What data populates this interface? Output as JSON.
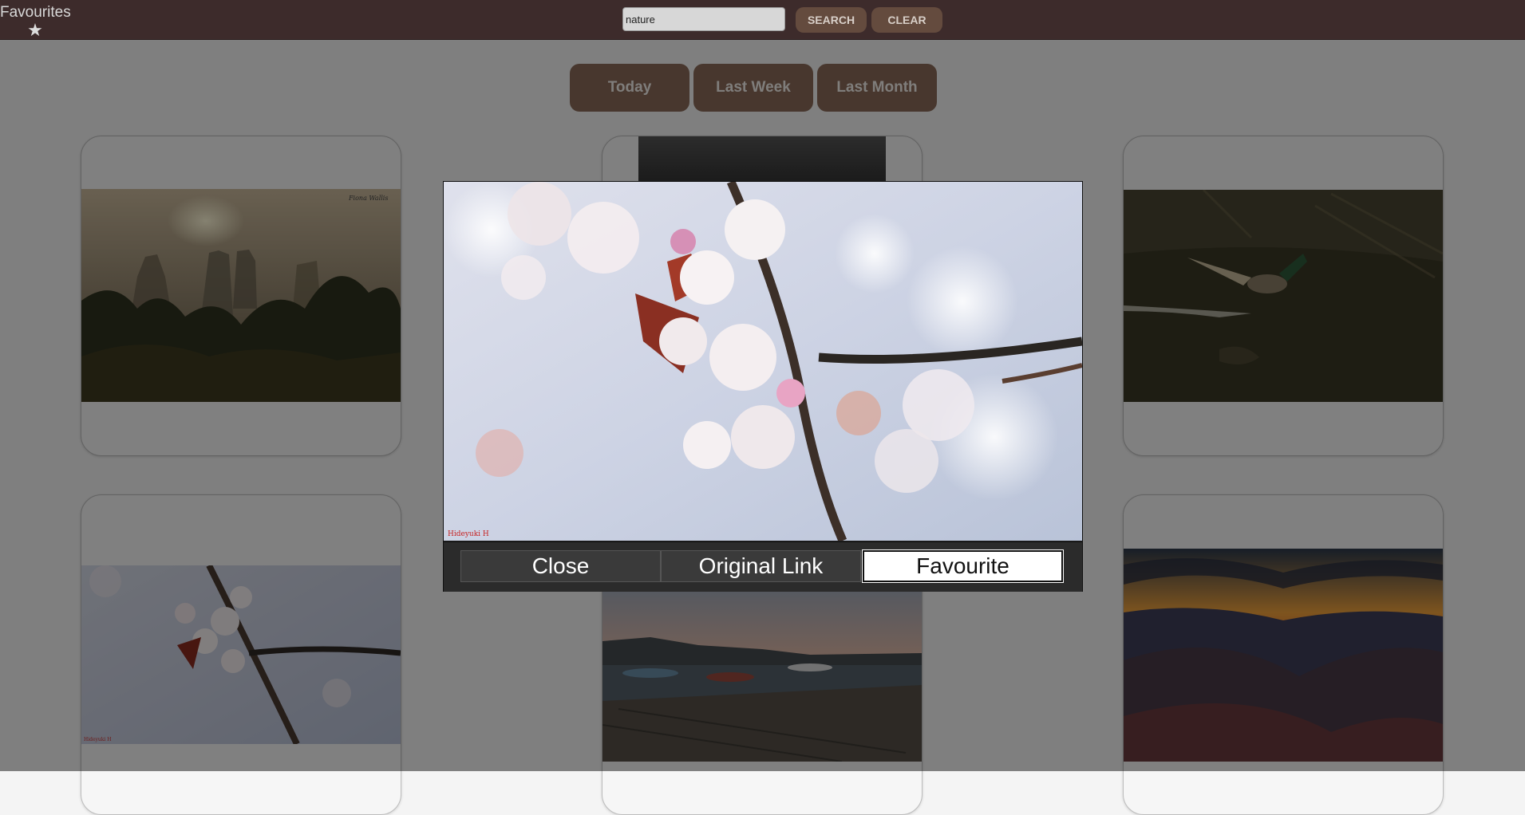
{
  "header": {
    "favourites_label": "Favourites",
    "search_value": "nature",
    "search_label": "SEARCH",
    "clear_label": "CLEAR"
  },
  "filters": {
    "today": "Today",
    "last_week": "Last Week",
    "last_month": "Last Month"
  },
  "gallery": {
    "photos": [
      {
        "subject": "misty forest with rock towers at sunrise",
        "watermark": "Fiona Wallis"
      },
      {
        "subject": "dark cloudy sky"
      },
      {
        "subject": "mallard duck landing on water"
      },
      {
        "subject": "cherry blossom branch",
        "watermark": "Hideyuki H"
      },
      {
        "subject": "harbour with fishing boats at dusk"
      },
      {
        "subject": "mountain valley at sunset"
      }
    ]
  },
  "modal": {
    "photo_subject": "cherry blossom branch",
    "watermark": "Hideyuki H",
    "close_label": "Close",
    "original_link_label": "Original Link",
    "favourite_label": "Favourite"
  },
  "colors": {
    "topbar": "#3d2b2b",
    "button": "#644b3e",
    "filter_button": "#8a6a58",
    "overlay": "rgba(0,0,0,0.48)"
  }
}
